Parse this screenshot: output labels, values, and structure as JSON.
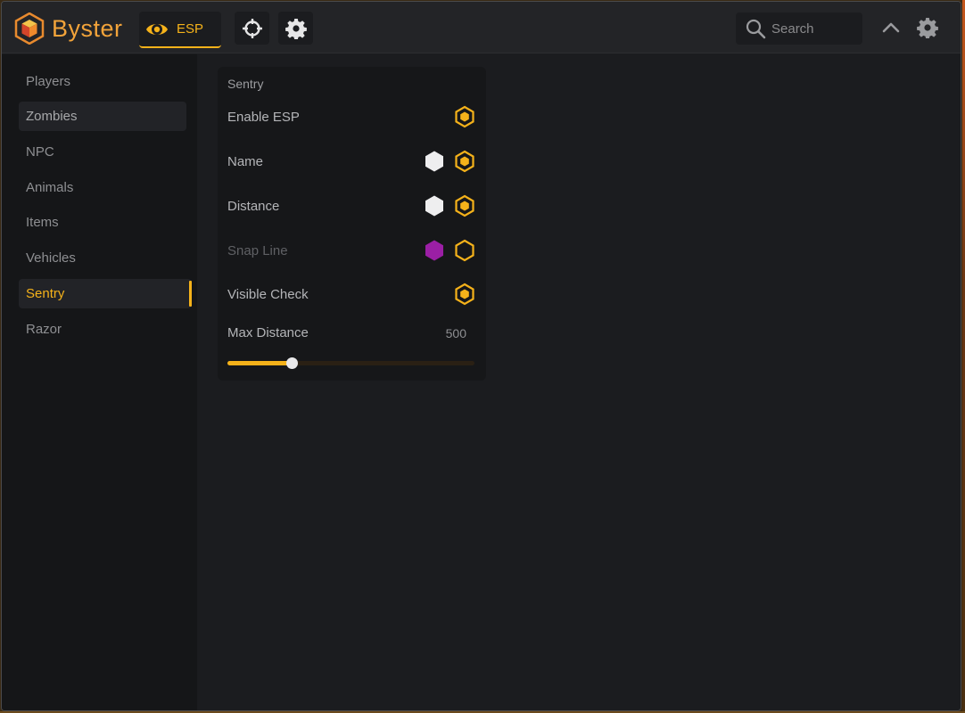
{
  "app": {
    "name": "Byster",
    "accent": "#f5b21a",
    "brand_color": "#f2a33a"
  },
  "topbar": {
    "tabs": [
      {
        "label": "ESP",
        "icon": "eye-icon",
        "active": true
      },
      {
        "label": "",
        "icon": "crosshair-icon",
        "active": false
      },
      {
        "label": "",
        "icon": "gear-icon",
        "active": false
      }
    ],
    "search_placeholder": "Search",
    "collapse_icon": "chevron-up-icon",
    "settings_icon": "gear-icon"
  },
  "sidebar": {
    "items": [
      {
        "label": "Players",
        "state": "normal"
      },
      {
        "label": "Zombies",
        "state": "hover"
      },
      {
        "label": "NPC",
        "state": "normal"
      },
      {
        "label": "Animals",
        "state": "normal"
      },
      {
        "label": "Items",
        "state": "normal"
      },
      {
        "label": "Vehicles",
        "state": "normal"
      },
      {
        "label": "Sentry",
        "state": "active"
      },
      {
        "label": "Razor",
        "state": "normal"
      }
    ]
  },
  "panel": {
    "title": "Sentry",
    "rows": [
      {
        "label": "Enable ESP",
        "color_swatch": null,
        "toggle": true,
        "disabled": false
      },
      {
        "label": "Name",
        "color_swatch": "#eeeeef",
        "toggle": true,
        "disabled": false
      },
      {
        "label": "Distance",
        "color_swatch": "#eeeeef",
        "toggle": true,
        "disabled": false
      },
      {
        "label": "Snap Line",
        "color_swatch": "#9b1fa5",
        "toggle": false,
        "disabled": true
      },
      {
        "label": "Visible Check",
        "color_swatch": null,
        "toggle": true,
        "disabled": false
      }
    ],
    "slider": {
      "label": "Max Distance",
      "value": "500",
      "fraction": 0.26
    }
  }
}
